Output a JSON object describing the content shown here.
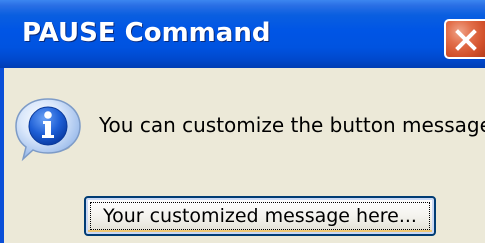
{
  "window": {
    "title": "PAUSE Command"
  },
  "titlebar": {
    "close_icon": "close-icon",
    "colors": {
      "titlebar_blue": "#0055e5",
      "close_red": "#d2502a",
      "dialog_background": "#ece9d8"
    }
  },
  "dialog": {
    "icon": "info-icon",
    "message": "You can customize the button message!",
    "button_label": "Your customized message here..."
  }
}
